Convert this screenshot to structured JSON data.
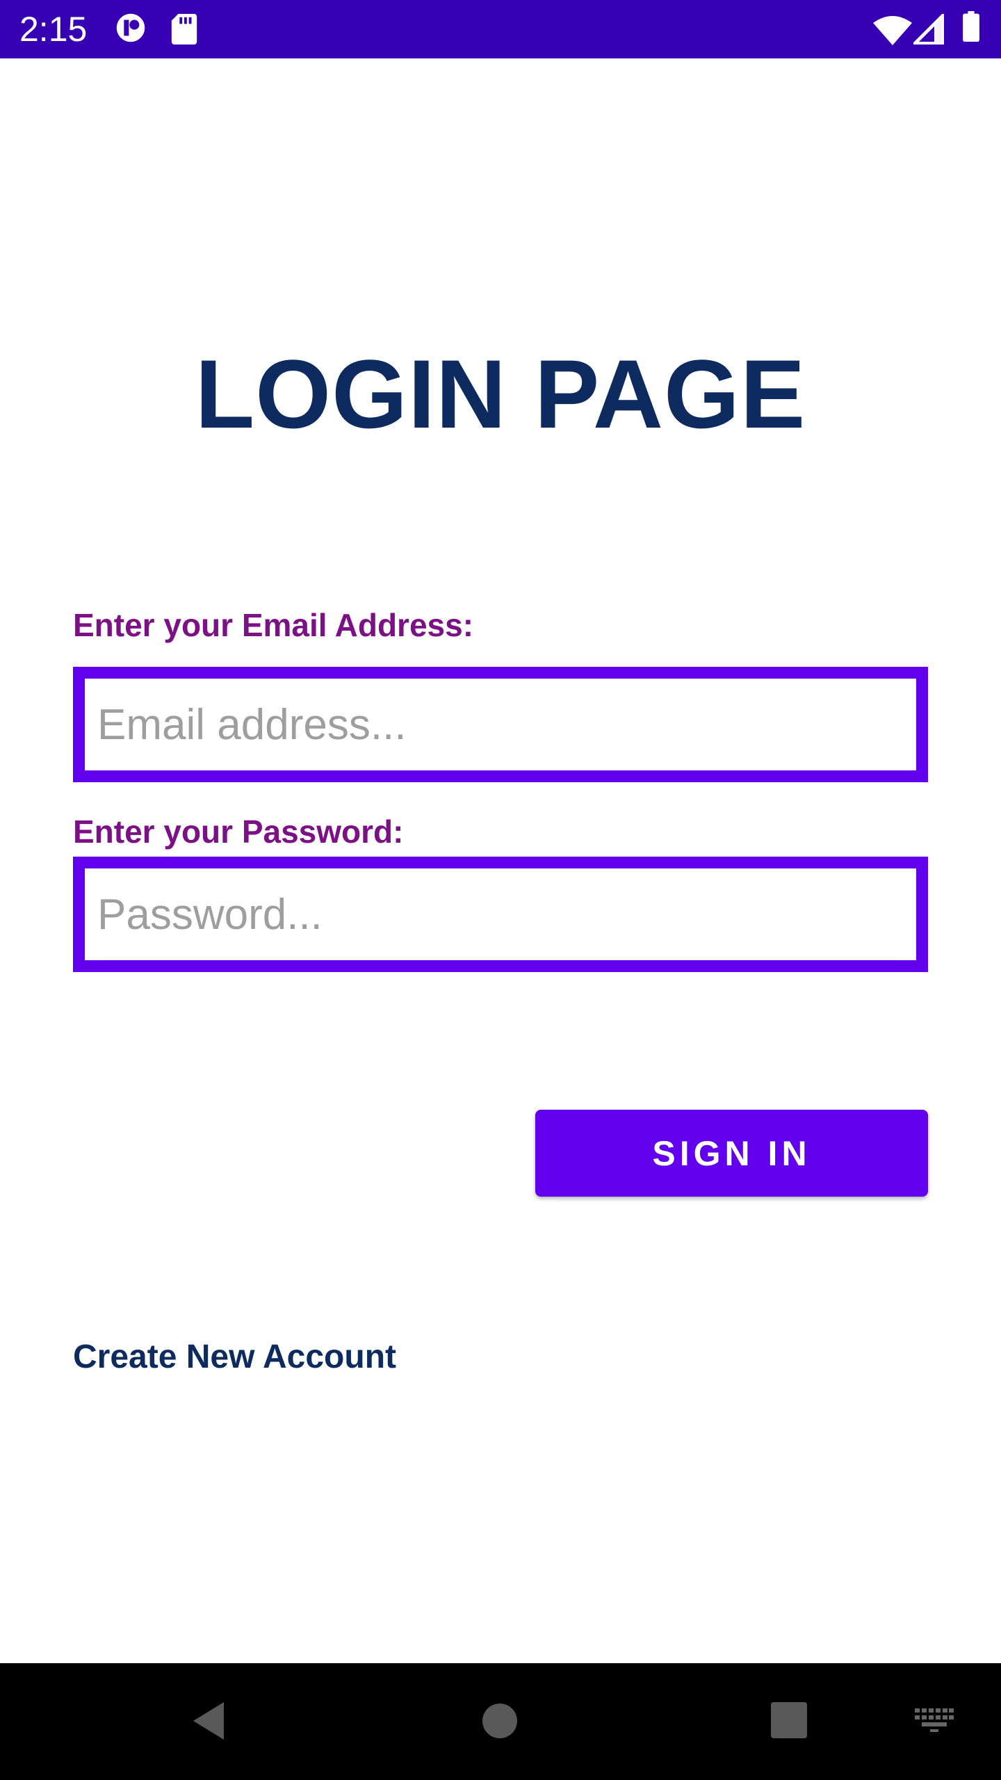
{
  "status_bar": {
    "time": "2:15",
    "icons": [
      "app-notification-icon",
      "sd-card-icon",
      "wifi-icon",
      "cellular-signal-icon",
      "battery-icon"
    ],
    "background_color": "#3700b3"
  },
  "main": {
    "title": "LOGIN PAGE",
    "email": {
      "label": "Enter your Email Address:",
      "placeholder": "Email address...",
      "value": ""
    },
    "password": {
      "label": "Enter your Password:",
      "placeholder": "Password...",
      "value": ""
    },
    "sign_in_label": "SIGN IN",
    "create_account_label": "Create New Account"
  },
  "nav_bar": {
    "buttons": [
      "back-icon",
      "home-icon",
      "recents-icon",
      "keyboard-icon"
    ]
  },
  "colors": {
    "accent": "#6200ee",
    "title": "#0d2b5e",
    "label": "#7b1185",
    "placeholder": "#9e9e9e"
  }
}
